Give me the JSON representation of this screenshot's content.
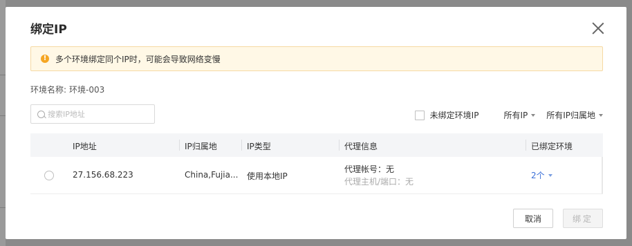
{
  "dialog": {
    "title": "绑定IP",
    "warning": "多个环境绑定同个IP时，可能会导致网络变慢",
    "env_name_label": "环境名称:",
    "env_name_value": "环境-003"
  },
  "search": {
    "placeholder": "搜索IP地址",
    "value": ""
  },
  "filters": {
    "unbound_checkbox_label": "未绑定环境IP",
    "unbound_checked": false,
    "ip_filter": "所有IP",
    "location_filter": "所有IP归属地"
  },
  "table": {
    "headers": [
      "IP地址",
      "IP归属地",
      "IP类型",
      "代理信息",
      "已绑定环境"
    ],
    "rows": [
      {
        "ip": "27.156.68.223",
        "location": "China,Fujia...",
        "type": "使用本地IP",
        "proxy_account": "代理帐号：无",
        "proxy_host": "代理主机/端口：无",
        "bound_envs": "2个",
        "selected": false
      }
    ]
  },
  "buttons": {
    "cancel": "取消",
    "confirm": "绑定"
  },
  "colors": {
    "warning_bg": "#fff8e6",
    "warning_icon": "#f5a623",
    "link_blue": "#3a6fd8",
    "disabled_text": "#b5b5b5"
  }
}
